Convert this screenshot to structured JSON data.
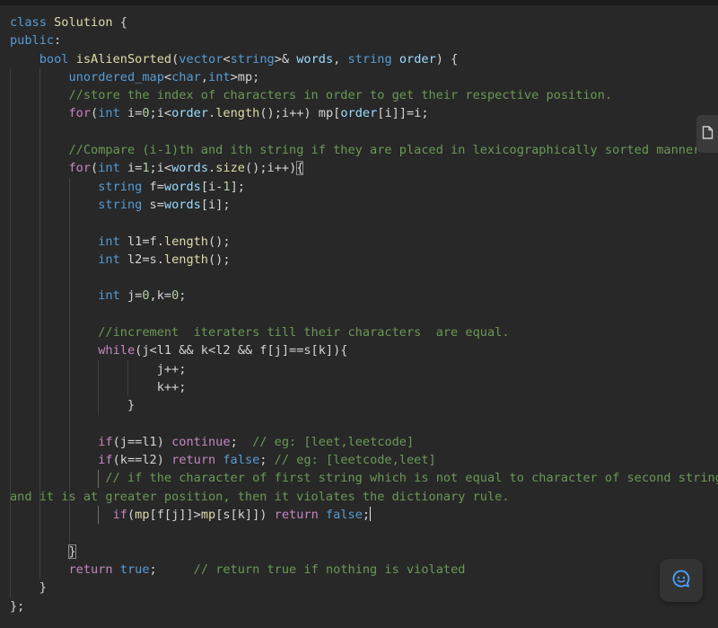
{
  "colors": {
    "background": "#282828",
    "keyword": "#c586c0",
    "type": "#569cd6",
    "function": "#dcdcaa",
    "comment": "#6a9955",
    "variable": "#9cdcfe",
    "number": "#b5cea8",
    "text": "#d4d4d4"
  },
  "icons": {
    "side_tab": "document-icon",
    "chat_button": "chat-smile-icon"
  },
  "code": {
    "lines": [
      [
        [
          "ty",
          "class"
        ],
        [
          "pl",
          " "
        ],
        [
          "fn",
          "Solution"
        ],
        [
          "pl",
          " {"
        ]
      ],
      [
        [
          "ty",
          "public"
        ],
        [
          "pl",
          ":"
        ]
      ],
      [
        [
          "pl",
          "    "
        ],
        [
          "ty",
          "bool"
        ],
        [
          "pl",
          " "
        ],
        [
          "fn",
          "isAlienSorted"
        ],
        [
          "pl",
          "("
        ],
        [
          "ty",
          "vector"
        ],
        [
          "pl",
          "<"
        ],
        [
          "ty",
          "string"
        ],
        [
          "pl",
          ">& "
        ],
        [
          "vr",
          "words"
        ],
        [
          "pl",
          ", "
        ],
        [
          "ty",
          "string"
        ],
        [
          "pl",
          " "
        ],
        [
          "vr",
          "order"
        ],
        [
          "pl",
          ") {"
        ]
      ],
      [
        [
          "pl",
          "        "
        ],
        [
          "ty",
          "unordered_map"
        ],
        [
          "pl",
          "<"
        ],
        [
          "ty",
          "char"
        ],
        [
          "pl",
          ","
        ],
        [
          "ty",
          "int"
        ],
        [
          "pl",
          ">mp;"
        ]
      ],
      [
        [
          "pl",
          "        "
        ],
        [
          "cm",
          "//store the index of characters in order to get their respective position."
        ]
      ],
      [
        [
          "pl",
          "        "
        ],
        [
          "kw",
          "for"
        ],
        [
          "pl",
          "("
        ],
        [
          "ty",
          "int"
        ],
        [
          "pl",
          " i="
        ],
        [
          "nm",
          "0"
        ],
        [
          "pl",
          ";i<"
        ],
        [
          "vr",
          "order"
        ],
        [
          "pl",
          "."
        ],
        [
          "fn",
          "length"
        ],
        [
          "pl",
          "();i++) mp["
        ],
        [
          "vr",
          "order"
        ],
        [
          "pl",
          "[i]]=i;"
        ]
      ],
      [
        [
          "pl",
          ""
        ]
      ],
      [
        [
          "pl",
          "        "
        ],
        [
          "cm",
          "//Compare (i-1)th and ith string if they are placed in lexicographically sorted manner"
        ]
      ],
      [
        [
          "pl",
          "        "
        ],
        [
          "kw",
          "for"
        ],
        [
          "pl",
          "("
        ],
        [
          "ty",
          "int"
        ],
        [
          "pl",
          " i="
        ],
        [
          "nm",
          "1"
        ],
        [
          "pl",
          ";i<"
        ],
        [
          "vr",
          "words"
        ],
        [
          "pl",
          "."
        ],
        [
          "fn",
          "size"
        ],
        [
          "pl",
          "();i++)"
        ],
        [
          "br",
          "{"
        ]
      ],
      [
        [
          "pl",
          "            "
        ],
        [
          "ty",
          "string"
        ],
        [
          "pl",
          " f="
        ],
        [
          "vr",
          "words"
        ],
        [
          "pl",
          "[i-"
        ],
        [
          "nm",
          "1"
        ],
        [
          "pl",
          "];"
        ]
      ],
      [
        [
          "pl",
          "            "
        ],
        [
          "ty",
          "string"
        ],
        [
          "pl",
          " s="
        ],
        [
          "vr",
          "words"
        ],
        [
          "pl",
          "[i];"
        ]
      ],
      [
        [
          "pl",
          ""
        ]
      ],
      [
        [
          "pl",
          "            "
        ],
        [
          "ty",
          "int"
        ],
        [
          "pl",
          " l1=f."
        ],
        [
          "fn",
          "length"
        ],
        [
          "pl",
          "();"
        ]
      ],
      [
        [
          "pl",
          "            "
        ],
        [
          "ty",
          "int"
        ],
        [
          "pl",
          " l2=s."
        ],
        [
          "fn",
          "length"
        ],
        [
          "pl",
          "();"
        ]
      ],
      [
        [
          "pl",
          ""
        ]
      ],
      [
        [
          "pl",
          "            "
        ],
        [
          "ty",
          "int"
        ],
        [
          "pl",
          " j="
        ],
        [
          "nm",
          "0"
        ],
        [
          "pl",
          ",k="
        ],
        [
          "nm",
          "0"
        ],
        [
          "pl",
          ";"
        ]
      ],
      [
        [
          "pl",
          ""
        ]
      ],
      [
        [
          "pl",
          "            "
        ],
        [
          "cm",
          "//increment  iteraters till their characters  are equal."
        ]
      ],
      [
        [
          "pl",
          "            "
        ],
        [
          "kw",
          "while"
        ],
        [
          "pl",
          "(j<l1 && k<l2 && f[j]==s[k]){"
        ]
      ],
      [
        [
          "pl",
          "                    "
        ],
        [
          "pl",
          "j++;"
        ]
      ],
      [
        [
          "pl",
          "                    "
        ],
        [
          "pl",
          "k++;"
        ]
      ],
      [
        [
          "pl",
          "                "
        ],
        [
          "pl",
          "}"
        ]
      ],
      [
        [
          "pl",
          ""
        ]
      ],
      [
        [
          "pl",
          "            "
        ],
        [
          "kw",
          "if"
        ],
        [
          "pl",
          "(j==l1) "
        ],
        [
          "kw",
          "continue"
        ],
        [
          "pl",
          ";  "
        ],
        [
          "cm",
          "// eg: [leet,leetcode]"
        ]
      ],
      [
        [
          "pl",
          "            "
        ],
        [
          "kw",
          "if"
        ],
        [
          "pl",
          "(k==l2) "
        ],
        [
          "kw",
          "return"
        ],
        [
          "pl",
          " "
        ],
        [
          "ty",
          "false"
        ],
        [
          "pl",
          "; "
        ],
        [
          "cm",
          "// eg: [leetcode,leet]"
        ]
      ],
      [
        [
          "pl",
          "             "
        ],
        [
          "cm",
          "// if the character of first string which is not equal to character of second string"
        ]
      ],
      [
        [
          "cm",
          "and it is at greater position, then it violates the dictionary rule."
        ]
      ],
      [
        [
          "pl",
          "              "
        ],
        [
          "kw",
          "if"
        ],
        [
          "pl",
          "("
        ],
        [
          "fn",
          "mp"
        ],
        [
          "pl",
          "[f[j]]>"
        ],
        [
          "fn",
          "mp"
        ],
        [
          "pl",
          "[s[k]]) "
        ],
        [
          "kw",
          "return"
        ],
        [
          "pl",
          " "
        ],
        [
          "ty",
          "false"
        ],
        [
          "pl",
          ";"
        ],
        [
          "cur",
          ""
        ]
      ],
      [
        [
          "pl",
          ""
        ]
      ],
      [
        [
          "pl",
          "        "
        ],
        [
          "br",
          "}"
        ]
      ],
      [
        [
          "pl",
          "        "
        ],
        [
          "kw",
          "return"
        ],
        [
          "pl",
          " "
        ],
        [
          "ty",
          "true"
        ],
        [
          "pl",
          ";     "
        ],
        [
          "cm",
          "// return true if nothing is violated"
        ]
      ],
      [
        [
          "pl",
          "    "
        ],
        [
          "pl",
          "}"
        ]
      ],
      [
        [
          "pl",
          "};"
        ]
      ]
    ]
  }
}
